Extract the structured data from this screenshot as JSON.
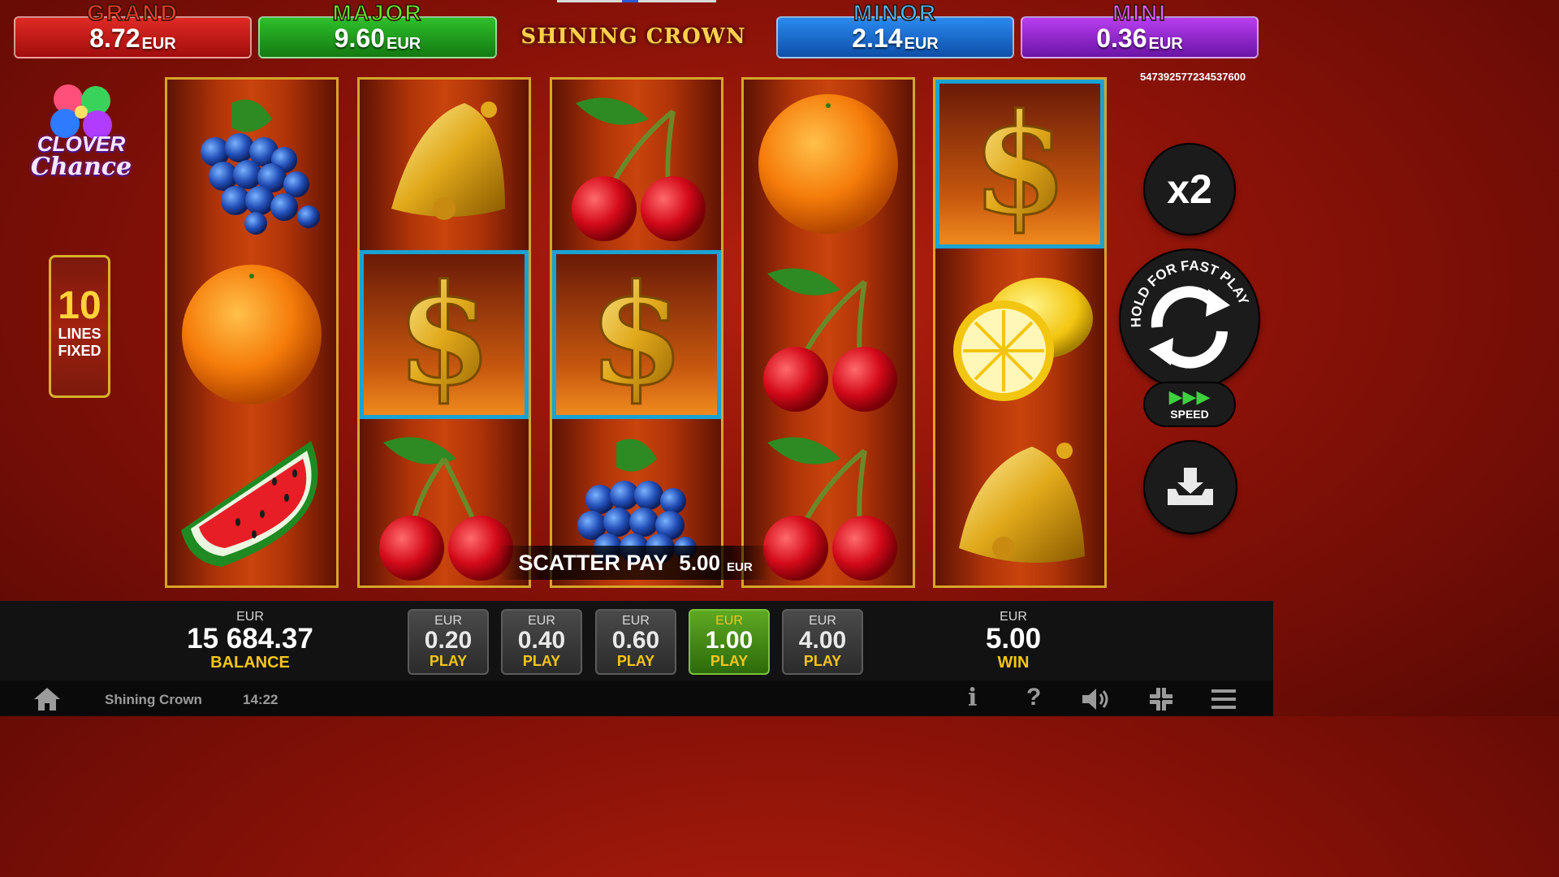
{
  "jackpots": [
    {
      "name": "GRAND",
      "amount": "8.72",
      "currency": "EUR",
      "color": "#c81818",
      "title_color": "#ff3b2f"
    },
    {
      "name": "MAJOR",
      "amount": "9.60",
      "currency": "EUR",
      "color": "#1f9a1f",
      "title_color": "#5fe02a"
    },
    {
      "name": "MINOR",
      "amount": "2.14",
      "currency": "EUR",
      "color": "#1565c8",
      "title_color": "#3fa6ff"
    },
    {
      "name": "MINI",
      "amount": "0.36",
      "currency": "EUR",
      "color": "#8a1fc8",
      "title_color": "#d34bff"
    }
  ],
  "game_title": "SHINING CROWN",
  "round_id": "547392577234537600",
  "logo": {
    "line1": "CLOVER",
    "line2": "Chance"
  },
  "lines": {
    "count": "10",
    "label1": "LINES",
    "label2": "FIXED"
  },
  "reels": [
    [
      "grapes",
      "orange",
      "watermelon"
    ],
    [
      "bell",
      "dollar-scatter",
      "cherry"
    ],
    [
      "cherry",
      "dollar-scatter",
      "grapes"
    ],
    [
      "orange",
      "cherry",
      "cherry"
    ],
    [
      "dollar-scatter",
      "lemon",
      "bell"
    ]
  ],
  "scatter": {
    "label": "SCATTER PAY",
    "value": "5.00",
    "currency": "EUR"
  },
  "controls": {
    "multiplier": "x2",
    "spin_hint": "HOLD FOR FAST PLAY",
    "speed_label": "SPEED"
  },
  "balance": {
    "currency": "EUR",
    "value": "15 684.37",
    "label": "BALANCE"
  },
  "win": {
    "currency": "EUR",
    "value": "5.00",
    "label": "WIN"
  },
  "bets": [
    {
      "currency": "EUR",
      "value": "0.20",
      "label": "PLAY",
      "selected": false
    },
    {
      "currency": "EUR",
      "value": "0.40",
      "label": "PLAY",
      "selected": false
    },
    {
      "currency": "EUR",
      "value": "0.60",
      "label": "PLAY",
      "selected": false
    },
    {
      "currency": "EUR",
      "value": "1.00",
      "label": "PLAY",
      "selected": true
    },
    {
      "currency": "EUR",
      "value": "4.00",
      "label": "PLAY",
      "selected": false
    }
  ],
  "footer": {
    "game_name": "Shining Crown",
    "time": "14:22"
  },
  "icons": [
    "home-icon",
    "info-icon",
    "help-icon",
    "sound-icon",
    "fullscreen-icon",
    "menu-icon"
  ]
}
